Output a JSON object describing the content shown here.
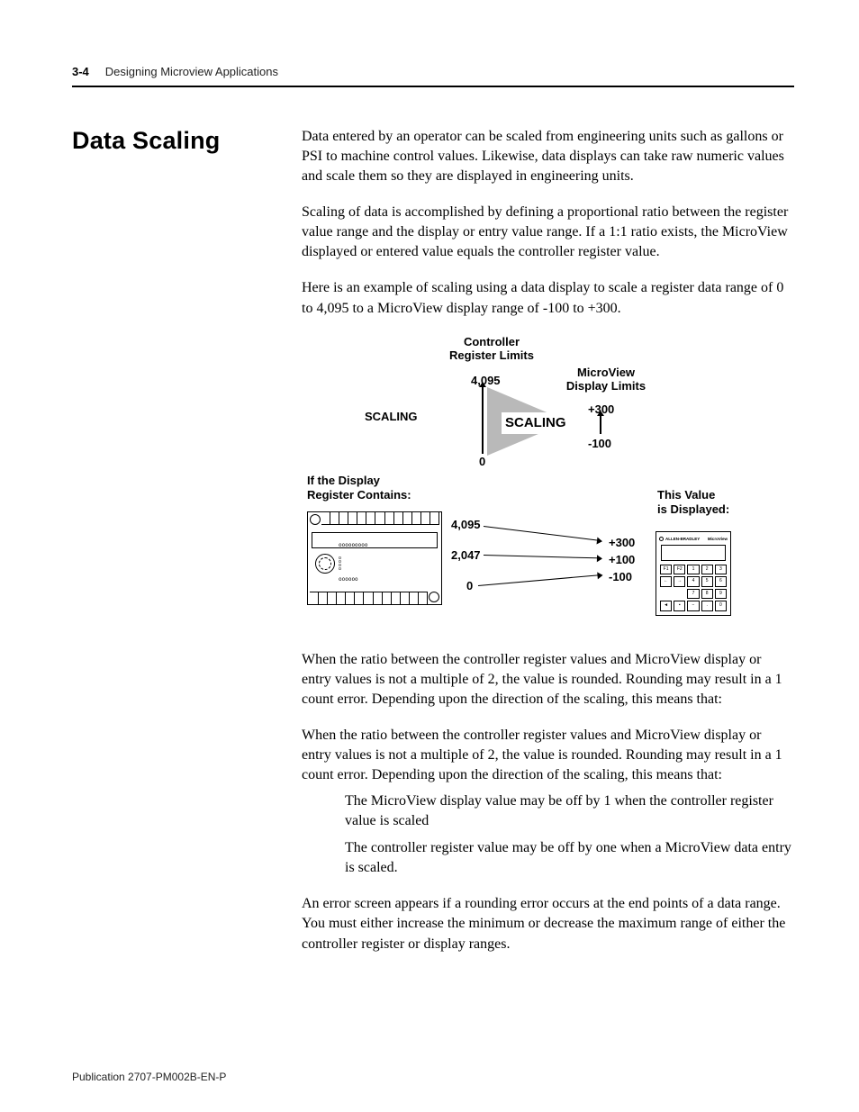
{
  "header": {
    "page_num": "3-4",
    "chapter_title": "Designing Microview Applications"
  },
  "sidebar": {
    "heading": "Data Scaling"
  },
  "body": {
    "para1": "Data entered by an operator can be scaled from engineering units such as gallons or PSI to machine control values.  Likewise, data displays can take raw numeric values and scale them so they are displayed in engineering units.",
    "para2": "Scaling of data is accomplished by defining a proportional ratio between the register value range and the display or entry value range.  If a 1:1 ratio exists, the MicroView displayed or entered value equals the controller register value.",
    "para3": "Here is an example of scaling using a data display to scale a register data range of 0 to 4,095 to a MicroView display range of -100 to +300.",
    "para4": "When the ratio between the controller register values and MicroView display or entry values is not a multiple of 2, the value is rounded.  Rounding  may result in a 1 count error.  Depending upon the direction of the scaling, this means that:",
    "para5": "When the ratio between the controller register values and MicroView display or entry values is not a multiple of 2, the value is rounded.  Rounding  may result in a 1 count error.  Depending upon the direction of the scaling, this means that:",
    "bullet1": "The MicroView display value may be off by 1 when the controller register value is scaled",
    "bullet2": "The controller register value may be off by one when a MicroView data entry is scaled.",
    "para6": "An error screen appears if a rounding error occurs at the end points of a data range.  You must either increase the minimum or decrease the maximum range of either the controller register or display ranges."
  },
  "diagram": {
    "ctrl_limits_label": "Controller\nRegister Limits",
    "ctrl_max": "4,095",
    "ctrl_min": "0",
    "mv_limits_label": "MicroView\nDisplay Limits",
    "mv_max": "+300",
    "mv_min": "-100",
    "scaling_left": "SCALING",
    "scaling_center": "SCALING",
    "left_caption": "If the Display\nRegister Contains:",
    "right_caption": "This Value\nis Displayed:",
    "map_in": [
      "4,095",
      "2,047",
      "0"
    ],
    "map_out": [
      "+300",
      "+100",
      "-100"
    ],
    "mv_brand": "ALLEN-BRADLEY",
    "mv_model": "MicroView",
    "mv_keys": [
      "F1",
      "F2",
      "1",
      "2",
      "3",
      "←",
      "→",
      "4",
      "5",
      "6",
      "",
      "",
      "7",
      "8",
      "9",
      "◄",
      "▪",
      "−",
      ".",
      "0"
    ]
  },
  "footer": {
    "pub": "Publication 2707-PM002B-EN-P"
  }
}
